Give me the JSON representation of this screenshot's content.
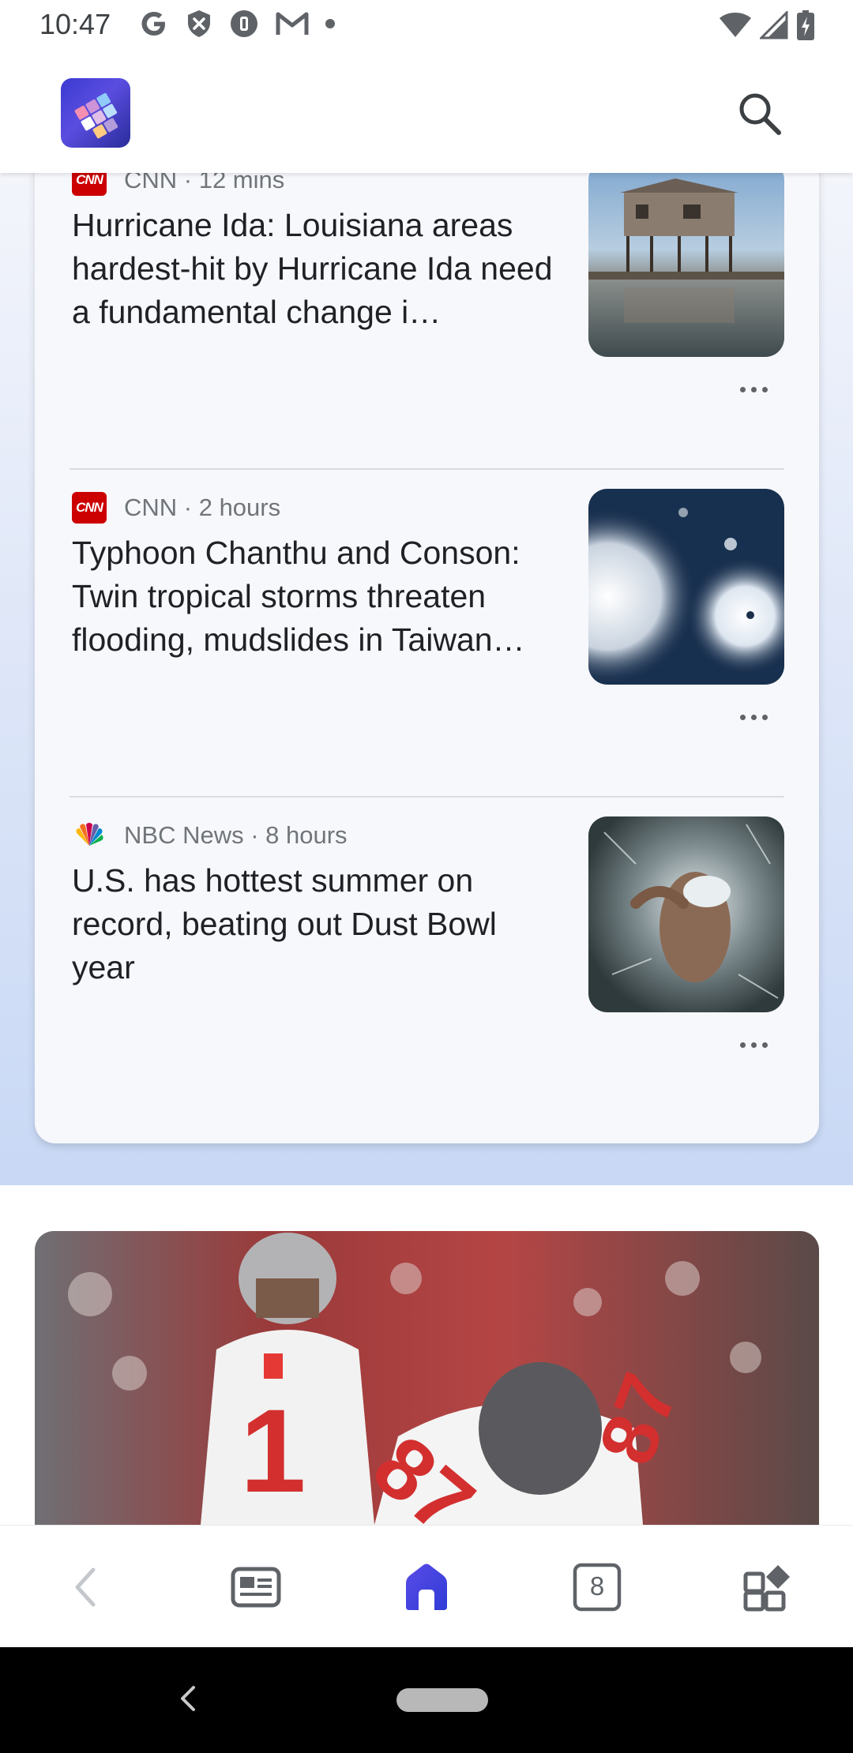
{
  "status_bar": {
    "time": "10:47",
    "left_icons": [
      "google-g-icon",
      "shield-x-icon",
      "vpn-key-icon",
      "gmail-icon",
      "dot-icon"
    ],
    "right_icons": [
      "wifi-icon",
      "signal-icon",
      "battery-icon"
    ]
  },
  "header": {
    "logo": "app-logo",
    "search_icon": "search-icon"
  },
  "articles": [
    {
      "source": "CNN · 12 mins",
      "source_icon": "cnn-icon",
      "title": "Hurricane Ida: Louisiana areas hardest-hit by Hurricane Ida need a fundamental change i…"
    },
    {
      "source": "CNN · 2 hours",
      "source_icon": "cnn-icon",
      "title": "Typhoon Chanthu and Conson: Twin tropical storms threaten flooding, mudslides in Taiwan…"
    },
    {
      "source": "NBC News · 8 hours",
      "source_icon": "nbc-peacock-icon",
      "title": "U.S. has hottest summer on record, beating out Dust Bowl year"
    }
  ],
  "bottom_nav": {
    "items": [
      "back-icon",
      "news-icon",
      "home-icon",
      "tabs-icon",
      "apps-icon"
    ],
    "tab_count": "8",
    "accent_color": "#3b3be0"
  }
}
